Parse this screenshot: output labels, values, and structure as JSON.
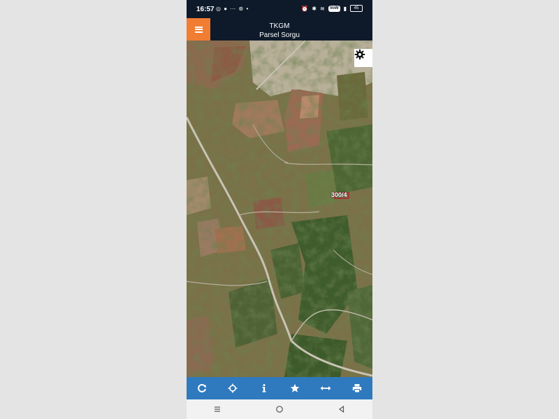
{
  "status_bar": {
    "time": "16:57",
    "left_icons": [
      "whatsapp-icon",
      "message-icon",
      "dots-icon",
      "circle-icon"
    ],
    "right_icons": [
      "alarm-icon",
      "bluetooth-icon",
      "wifi-icon",
      "signal-icon",
      "battery-icon"
    ],
    "battery": "45"
  },
  "header": {
    "title": "TKGM",
    "subtitle": "Parsel Sorgu",
    "menu_icon": "hamburger-menu-icon"
  },
  "map": {
    "settings_icon": "gear-icon",
    "parcel_label": "300/4",
    "accent": "#c8102e"
  },
  "toolbar": {
    "color": "#2f79bf",
    "buttons": [
      "refresh-icon",
      "crosshair-icon",
      "info-icon",
      "star-icon",
      "measure-icon",
      "print-icon"
    ]
  },
  "nav_bar": {
    "buttons": [
      "recents-icon",
      "home-icon",
      "back-icon"
    ]
  },
  "colors": {
    "header_bg": "#0e1a2a",
    "menu_accent": "#f07d32"
  }
}
